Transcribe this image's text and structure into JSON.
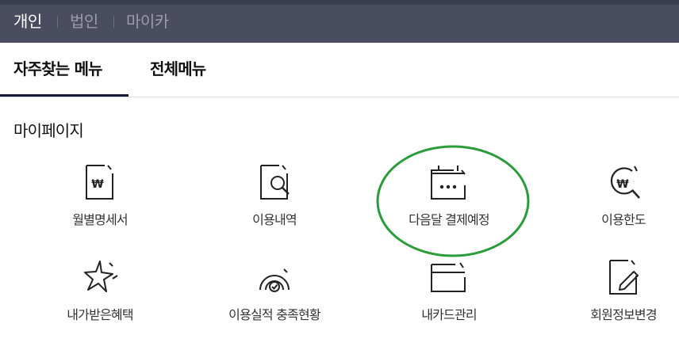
{
  "header": {
    "segments": [
      "개인",
      "법인",
      "마이카"
    ],
    "active_segment": "개인"
  },
  "tabs": [
    {
      "label": "자주찾는 메뉴",
      "active": true
    },
    {
      "label": "전체메뉴",
      "active": false
    }
  ],
  "section": {
    "title": "마이페이지"
  },
  "menu": [
    {
      "label": "월별명세서",
      "icon": "won-document-icon"
    },
    {
      "label": "이용내역",
      "icon": "document-search-icon"
    },
    {
      "label": "다음달 결제예정",
      "icon": "calendar-dots-icon",
      "highlighted": true
    },
    {
      "label": "이용한도",
      "icon": "won-search-icon"
    },
    {
      "label": "내가받은혜택",
      "icon": "star-wand-icon"
    },
    {
      "label": "이용실적 충족현황",
      "icon": "gauge-check-icon"
    },
    {
      "label": "내카드관리",
      "icon": "card-icon"
    },
    {
      "label": "회원정보변경",
      "icon": "document-pen-icon"
    }
  ],
  "colors": {
    "header_bg": "#4a4d60",
    "tab_underline": "#15193a",
    "annotation_circle": "#2a9d3a"
  }
}
